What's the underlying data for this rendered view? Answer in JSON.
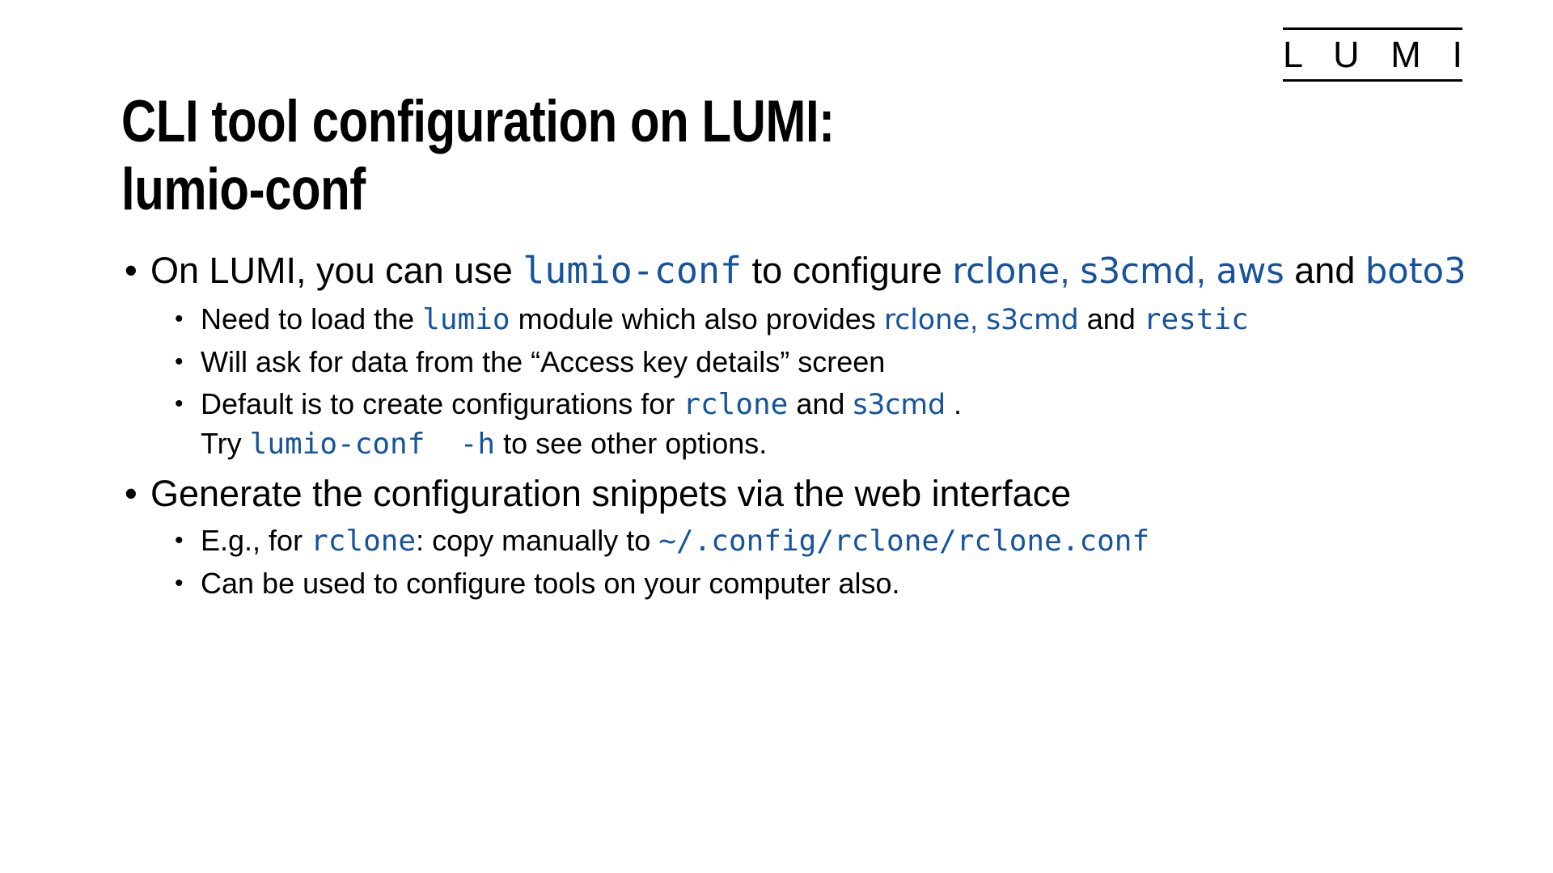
{
  "slide": {
    "title": "CLI tool configuration on LUMI:\nlumio-conf",
    "accent_color": "#15539E",
    "text_color": "#000000",
    "background_color": "#FFFFFF"
  },
  "logo": {
    "word": "L U M I",
    "name": "LUMI"
  },
  "content": {
    "bullets": [
      {
        "level": 1,
        "id": "bullet-lumio-conf-intro",
        "runs": [
          {
            "t": "On LUMI, you can use ",
            "s": "plain"
          },
          {
            "t": "lumio-conf",
            "s": "code"
          },
          {
            "t": " to configure ",
            "s": "plain"
          },
          {
            "t": "rclone",
            "s": "code-sans"
          },
          {
            "t": ", ",
            "s": "accent"
          },
          {
            "t": "s3cmd",
            "s": "code-sans"
          },
          {
            "t": ", ",
            "s": "accent"
          },
          {
            "t": "aws",
            "s": "code-sans"
          },
          {
            "t": " and ",
            "s": "plain"
          },
          {
            "t": "boto3",
            "s": "code-sans"
          }
        ]
      },
      {
        "level": 2,
        "id": "bullet-load-lumio-module",
        "runs": [
          {
            "t": "Need to load the ",
            "s": "plain"
          },
          {
            "t": "lumio",
            "s": "code"
          },
          {
            "t": " module which also provides ",
            "s": "plain"
          },
          {
            "t": "rclone",
            "s": "code-sans"
          },
          {
            "t": ", ",
            "s": "accent"
          },
          {
            "t": "s3cmd",
            "s": "code-sans"
          },
          {
            "t": " and ",
            "s": "plain"
          },
          {
            "t": "restic",
            "s": "code"
          }
        ]
      },
      {
        "level": 2,
        "id": "bullet-access-key-details",
        "runs": [
          {
            "t": "Will ask for data from the “Access key details” screen",
            "s": "plain"
          }
        ]
      },
      {
        "level": 2,
        "id": "bullet-default-configurations",
        "runs": [
          {
            "t": "Default is to create configurations for ",
            "s": "plain"
          },
          {
            "t": "rclone",
            "s": "code"
          },
          {
            "t": " and ",
            "s": "plain"
          },
          {
            "t": "s3cmd",
            "s": "code-sans"
          },
          {
            "t": " .\n",
            "s": "plain"
          },
          {
            "t": "Try ",
            "s": "plain"
          },
          {
            "t": "lumio-conf  -h",
            "s": "code"
          },
          {
            "t": " to see other options.",
            "s": "plain"
          }
        ]
      },
      {
        "level": 1,
        "id": "bullet-generate-snippets",
        "runs": [
          {
            "t": "Generate the configuration snippets via the web interface",
            "s": "plain"
          }
        ]
      },
      {
        "level": 2,
        "id": "bullet-rclone-copy-path",
        "runs": [
          {
            "t": "E.g., for ",
            "s": "plain"
          },
          {
            "t": "rclone",
            "s": "code"
          },
          {
            "t": ": copy manually to ",
            "s": "plain"
          },
          {
            "t": "~/.config/rclone/rclone.conf",
            "s": "code"
          }
        ]
      },
      {
        "level": 2,
        "id": "bullet-configure-own-computer",
        "runs": [
          {
            "t": "Can be used to configure tools on your computer also.",
            "s": "plain"
          }
        ]
      }
    ],
    "bullet_glyph": "•"
  }
}
